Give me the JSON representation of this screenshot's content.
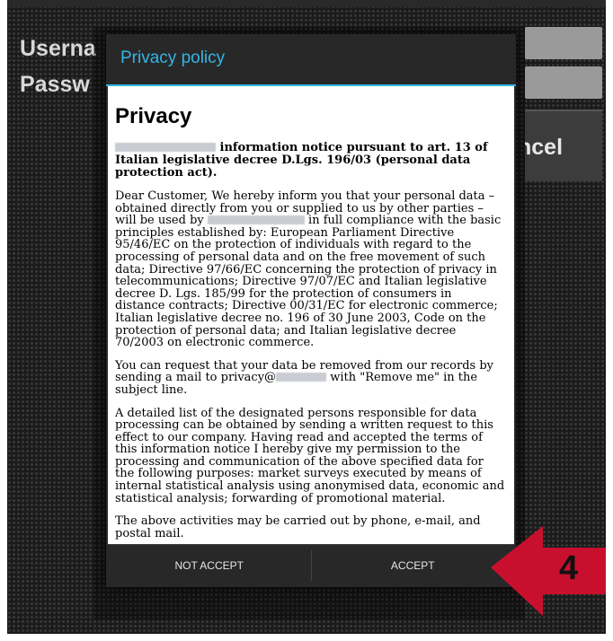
{
  "background": {
    "username_label": "Userna",
    "password_label": "Passw",
    "cancel_label": "ncel"
  },
  "dialog": {
    "title": "Privacy policy",
    "heading": "Privacy",
    "lead_text": "information notice pursuant to art. 13 of Italian legislative decree D.Lgs. 196/03 (personal data protection act).",
    "para1_a": "Dear Customer, We hereby inform you that your personal data – obtained directly from you or supplied to us by other parties – will be used by",
    "para1_b": "in full compliance with the basic principles established by: European Parliament Directive 95/46/EC on the protection of individuals with regard to the processing of personal data and on the free movement of such data; Directive 97/66/EC concerning the protection of privacy in telecommunications; Directive 97/07/EC and Italian legislative decree D. Lgs. 185/99 for the protection of consumers in distance contracts; Directive 00/31/EC for electronic commerce; Italian legislative decree no. 196 of 30 June 2003, Code on the protection of personal data; and Italian legislative decree 70/2003 on electronic commerce.",
    "para2_a": "You can request that your data be removed from our records by sending a mail to privacy@",
    "para2_b": "with \"Remove me\" in the subject line.",
    "para3": "A detailed list of the designated persons responsible for data processing can be obtained by sending a written request to this effect to our company. Having read and accepted the terms of this information notice I hereby give my permission to the processing and communication of the above specified data for the following purposes: market surveys executed by means of internal statistical analysis using anonymised data, economic and statistical analysis; forwarding of promotional material.",
    "para4": "The above activities may be carried out by phone, e-mail, and postal mail.",
    "not_accept_label": "NOT ACCEPT",
    "accept_label": "ACCEPT"
  },
  "annotation": {
    "step_number": "4",
    "arrow_color": "#c8102e"
  }
}
